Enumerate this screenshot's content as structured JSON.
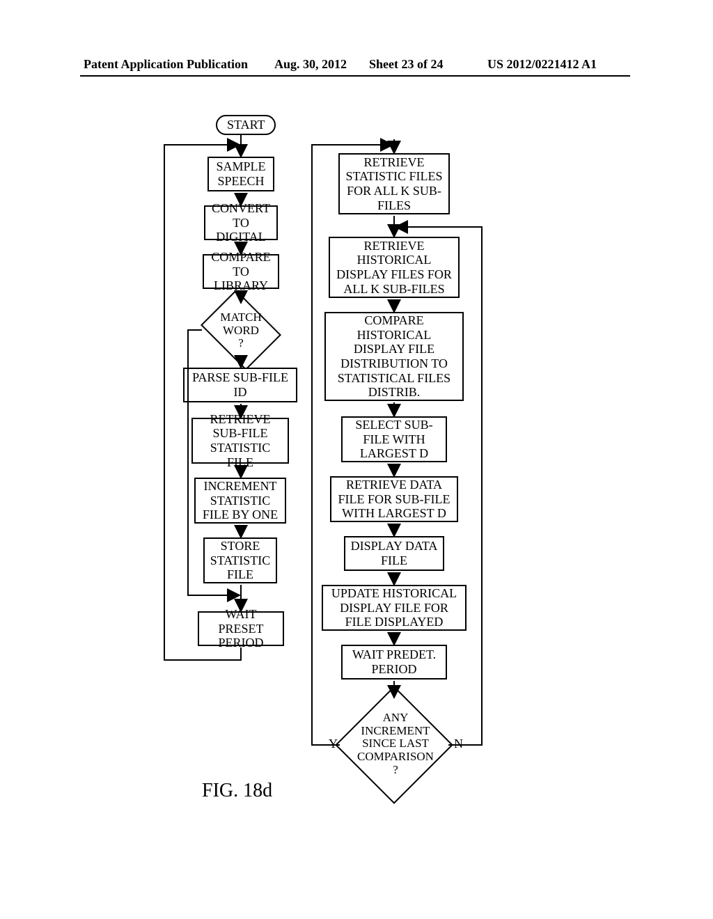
{
  "header": {
    "left": "Patent Application Publication",
    "date": "Aug. 30, 2012",
    "sheet": "Sheet 23 of 24",
    "pubno": "US 2012/0221412 A1"
  },
  "start": "START",
  "left": {
    "b1": "SAMPLE SPEECH",
    "b2": "CONVERT TO DIGITAL",
    "b3": "COMPARE TO LIBRARY",
    "d1": "MATCH WORD ?",
    "b4": "PARSE SUB-FILE ID",
    "b5": "RETRIEVE SUB-FILE STATISTIC FILE",
    "b6": "INCREMENT STATISTIC FILE BY ONE",
    "b7": "STORE STATISTIC FILE",
    "b8": "WAIT PRESET PERIOD"
  },
  "right": {
    "r1": "RETRIEVE STATISTIC FILES FOR ALL K SUB-FILES",
    "r2": "RETRIEVE HISTORICAL DISPLAY FILES FOR ALL K SUB-FILES",
    "r3": "COMPARE HISTORICAL DISPLAY FILE DISTRIBUTION TO STATISTICAL FILES DISTRIB.",
    "r4": "SELECT SUB-FILE WITH LARGEST D",
    "r5": "RETRIEVE DATA FILE FOR SUB-FILE WITH LARGEST D",
    "r6": "DISPLAY DATA FILE",
    "r7": "UPDATE HISTORICAL DISPLAY FILE FOR FILE DISPLAYED",
    "r8": "WAIT PREDET. PERIOD",
    "d2": "ANY INCREMENT SINCE LAST COMPARISON ?"
  },
  "edges": {
    "y": "Y",
    "n": "N"
  },
  "figure": "FIG. 18d"
}
